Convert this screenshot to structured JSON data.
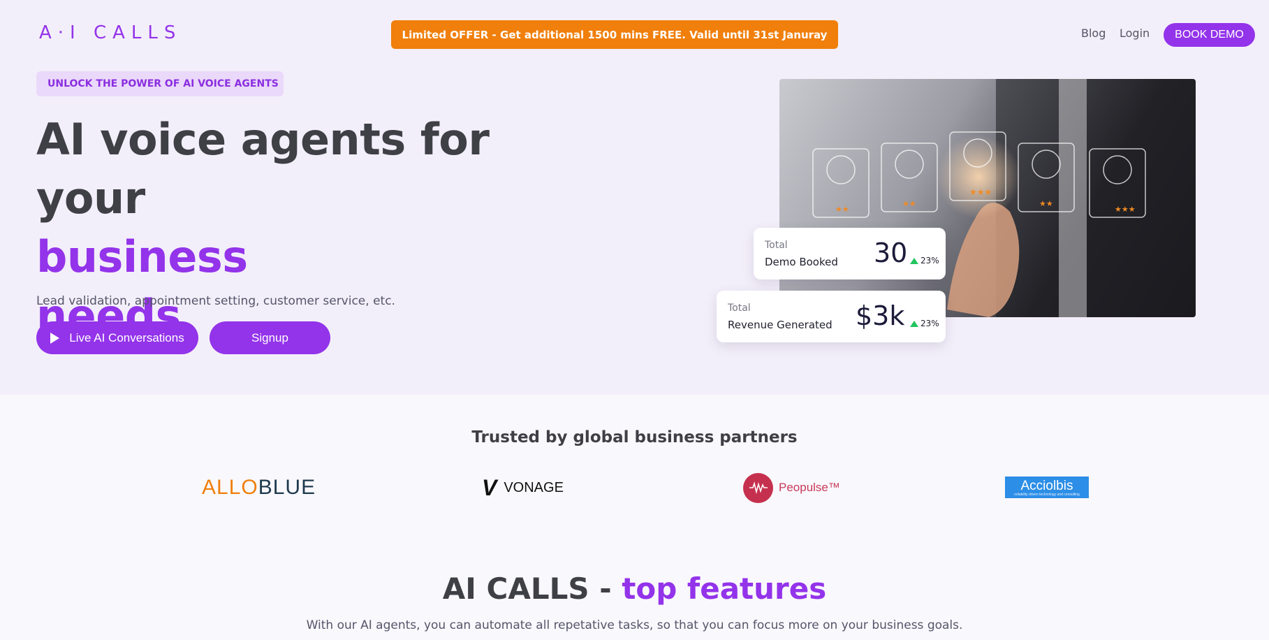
{
  "header": {
    "logo": "A·I CALLS",
    "offer": "Limited OFFER - Get additional 1500 mins FREE. Valid until 31st Januray",
    "nav": {
      "blog": "Blog",
      "login": "Login",
      "book_demo": "BOOK DEMO"
    }
  },
  "hero": {
    "badge": "UNLOCK THE POWER OF AI VOICE AGENTS",
    "headline_line1": "AI voice agents for your",
    "headline_line2": "business",
    "headline_line3": "needs",
    "subtitle": "Lead validation, appointment setting, customer service, etc.",
    "buttons": {
      "live": "Live AI Conversations",
      "signup": "Signup"
    },
    "stats": [
      {
        "label_top": "Total",
        "label": "Demo Booked",
        "value": "30",
        "change": "23%"
      },
      {
        "label_top": "Total",
        "label": "Revenue Generated",
        "value": "$3k",
        "change": "23%"
      }
    ]
  },
  "partners": {
    "title": "Trusted by global business partners",
    "items": [
      {
        "name_a": "ALLO",
        "name_b": "BLUE"
      },
      {
        "name": "VONAGE"
      },
      {
        "name": "Peopulse™"
      },
      {
        "name": "Acciolbis",
        "tagline": "reliability driven technology and consulting"
      }
    ]
  },
  "features": {
    "title_prefix": "AI CALLS - ",
    "title_accent": "top features",
    "subtitle": "With our AI agents, you can automate all repetative tasks, so that you can focus more on your business goals."
  },
  "colors": {
    "brand": "#9333ea",
    "offer": "#f07f0c",
    "up": "#22c55e"
  }
}
